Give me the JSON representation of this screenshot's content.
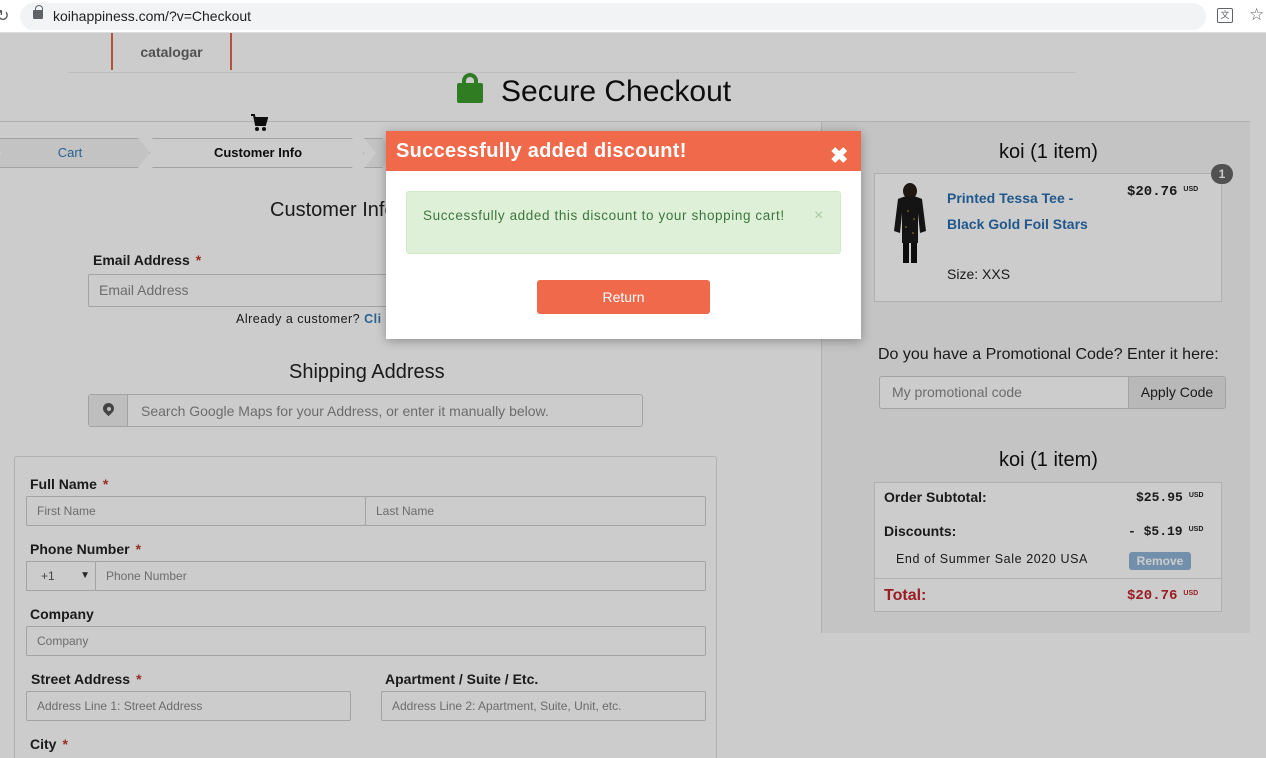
{
  "browser": {
    "url": "koihappiness.com/?v=Checkout"
  },
  "header": {
    "logo_text": "catalogar",
    "title": "Secure Checkout"
  },
  "breadcrumbs": [
    {
      "label": "Cart"
    },
    {
      "label": "Customer Info"
    }
  ],
  "customer_info": {
    "title": "Customer Info",
    "email_label": "Email Address",
    "required_mark": "*",
    "email_placeholder": "Email Address",
    "already_customer": "Already a customer?",
    "click_link": "Cli"
  },
  "shipping": {
    "title": "Shipping Address",
    "maps_placeholder": "Search Google Maps for your Address, or enter it manually below.",
    "full_name_label": "Full Name",
    "first_name_placeholder": "First Name",
    "last_name_placeholder": "Last Name",
    "phone_label": "Phone Number",
    "country_code": "+1",
    "phone_placeholder": "Phone Number",
    "company_label": "Company",
    "company_placeholder": "Company",
    "street_label": "Street Address",
    "street_placeholder": "Address Line 1: Street Address",
    "apt_label": "Apartment / Suite / Etc.",
    "apt_placeholder": "Address Line 2: Apartment, Suite, Unit, etc.",
    "city_label": "City"
  },
  "order": {
    "title": "koi (1 item)",
    "badge_count": "1",
    "item": {
      "name": "Printed Tessa Tee - Black Gold Foil Stars",
      "size": "Size: XXS",
      "price": "$20.76",
      "currency": "USD"
    },
    "promo_question": "Do you have a Promotional Code? Enter it here:",
    "promo_placeholder": "My promotional code",
    "apply_label": "Apply Code",
    "summary_title": "koi (1 item)",
    "subtotal_label": "Order Subtotal:",
    "subtotal_value": "$25.95",
    "discounts_label": "Discounts:",
    "discounts_value": "- $5.19",
    "discount_name": "End of Summer Sale 2020 USA",
    "remove_label": "Remove",
    "total_label": "Total:",
    "total_value": "$20.76",
    "currency": "USD"
  },
  "modal": {
    "title": "Successfully added discount!",
    "close_glyph": "✖",
    "message": "Successfully added this discount to your shopping cart!",
    "alert_close": "×",
    "return_label": "Return"
  },
  "colors": {
    "accent": "#f0694a",
    "link": "#2a6fb0",
    "success_bg": "#dff0d8",
    "total_red": "#c0262d",
    "secure_green": "#3b9c2b"
  }
}
